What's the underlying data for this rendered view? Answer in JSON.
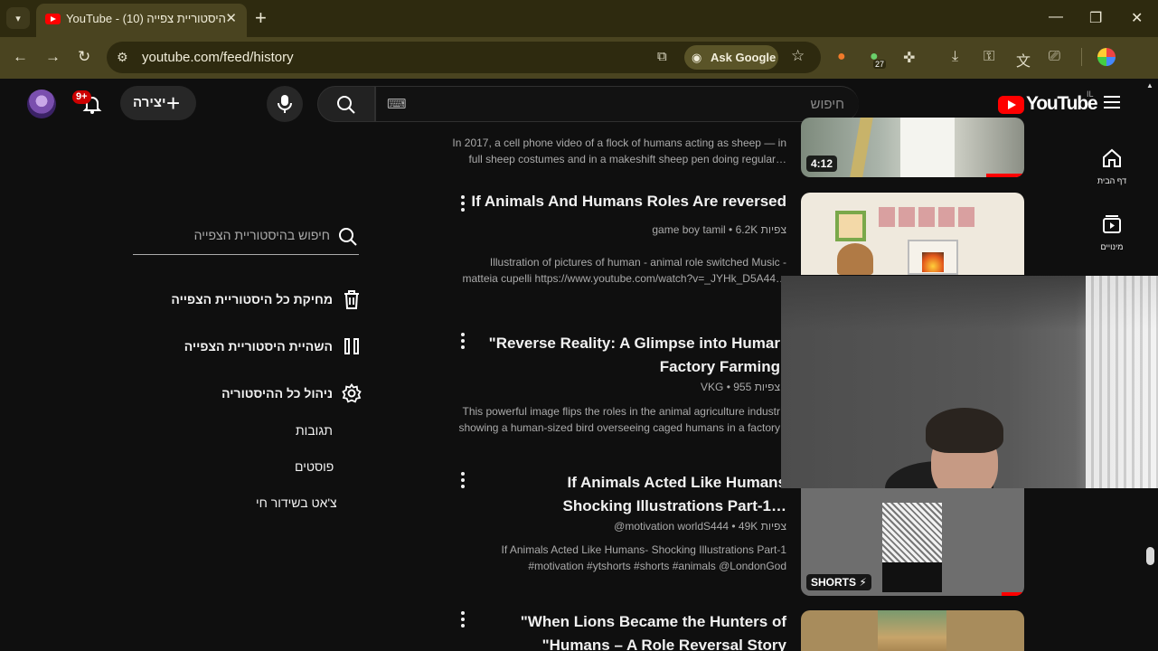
{
  "browser": {
    "tab_title": "YouTube - היסטוריית צפייה (10)",
    "url": "youtube.com/feed/history",
    "ask_google": "Ask Google",
    "extension_badge": "27"
  },
  "masthead": {
    "logo": "YouTube",
    "country": "IL",
    "search_placeholder": "חיפוש",
    "create_label": "יצירה",
    "notifications_badge": "9+"
  },
  "rail": [
    {
      "label": "דף הבית"
    },
    {
      "label": "מינויים"
    }
  ],
  "history_panel": {
    "search_placeholder": "חיפוש בהיסטוריית הצפייה",
    "actions": [
      {
        "label": "מחיקת כל היסטוריית הצפייה"
      },
      {
        "label": "השהיית היסטוריית הצפייה"
      },
      {
        "label": "ניהול כל ההיסטוריה"
      }
    ],
    "sub_links": [
      "תגובות",
      "פוסטים",
      "צ'אט בשידור חי"
    ]
  },
  "videos": [
    {
      "title": "",
      "meta": "",
      "desc_line1": "In 2017, a cell phone video of a flock of humans acting as sheep — in",
      "desc_line2": "full sheep costumes and in a makeshift sheep pen doing regular…",
      "badge": "4:12",
      "watched_fraction": 0.17
    },
    {
      "title": "If Animals And Humans Roles Are reversed",
      "meta": "game boy tamil • 6.2K צפיות",
      "desc_line1": "Illustration of pictures of human - animal role switched Music -",
      "desc_line2": "matteia cupelli https://www.youtube.com/watch?v=_JYHk_D5A44…"
    },
    {
      "title_line1": "\"Reverse Reality: A Glimpse into Humar",
      "title_line2": "Factory Farming",
      "meta": "VKG • 955 צפיות",
      "desc_line1": "This powerful image flips the roles in the animal agriculture industr",
      "desc_line2": "showing a human-sized bird overseeing caged humans in a factory"
    },
    {
      "title_line1": "If Animals Acted Like Humans",
      "title_line2": "Shocking Illustrations Part-1…",
      "meta": "@motivation worldS444 • 49K צפיות",
      "desc_line1": "If Animals Acted Like Humans- Shocking Illustrations Part-1",
      "desc_line2": "#motivation #ytshorts #shorts #animals @LondonGod",
      "badge": "SHORTS",
      "watched_fraction": 0.1
    },
    {
      "title_line1": "\"When Lions Became the Hunters of",
      "title_line2": "\"Humans – A Role Reversal Story"
    }
  ]
}
